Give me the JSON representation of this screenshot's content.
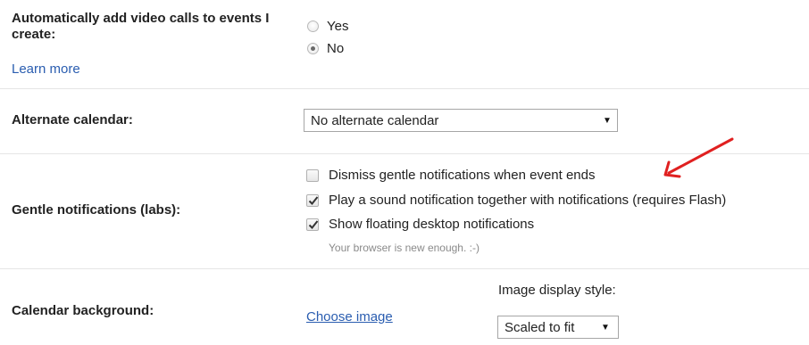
{
  "video_calls": {
    "label": "Automatically add video calls to events I create:",
    "learn_more": "Learn more",
    "options": [
      "Yes",
      "No"
    ],
    "selected": "No"
  },
  "alternate_calendar": {
    "label": "Alternate calendar:",
    "selected": "No alternate calendar",
    "arrow": "▼"
  },
  "gentle_notifications": {
    "label": "Gentle notifications (labs):",
    "options": [
      {
        "label": "Dismiss gentle notifications when event ends",
        "checked": false
      },
      {
        "label": "Play a sound notification together with notifications (requires Flash)",
        "checked": true
      },
      {
        "label": "Show floating desktop notifications",
        "checked": true
      }
    ],
    "note": "Your browser is new enough. :-)"
  },
  "calendar_background": {
    "label": "Calendar background:",
    "choose_image": "Choose image",
    "display_style_label": "Image display style:",
    "display_style_value": "Scaled to fit",
    "arrow": "▼"
  },
  "annotation": {
    "arrow_color": "#e02020"
  }
}
